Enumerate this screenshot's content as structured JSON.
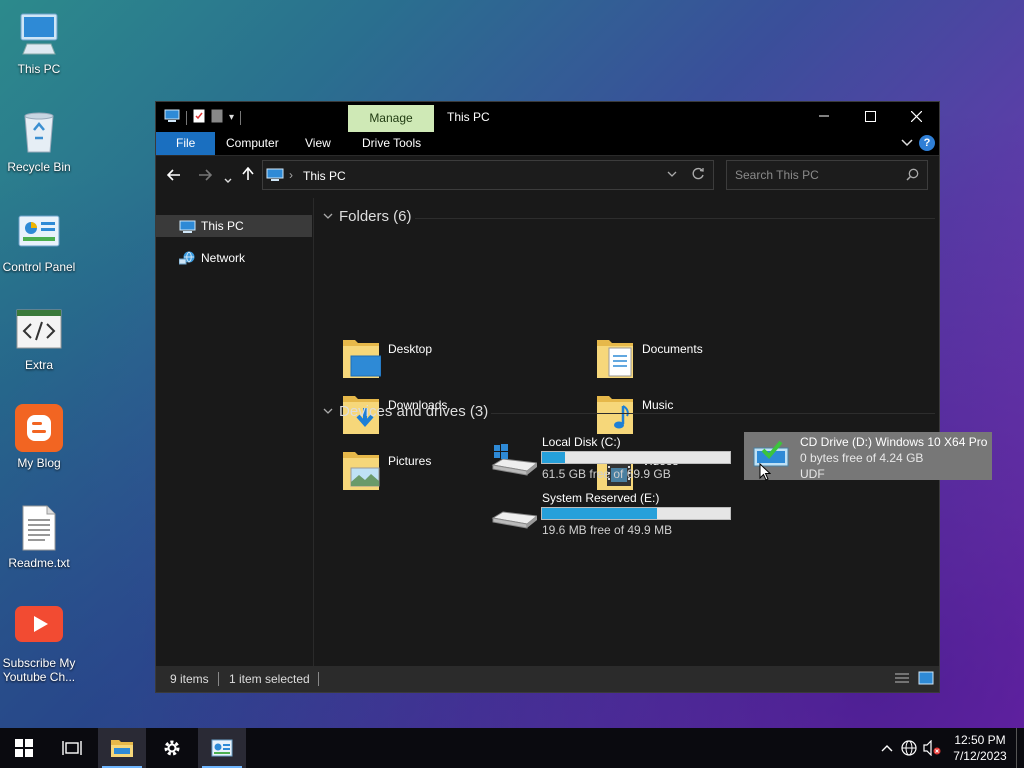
{
  "desktop": {
    "icons": [
      {
        "label": "This PC"
      },
      {
        "label": "Recycle Bin"
      },
      {
        "label": "Control Panel"
      },
      {
        "label": "Extra"
      },
      {
        "label": "My Blog"
      },
      {
        "label": "Readme.txt"
      },
      {
        "label": "Subscribe My Youtube Ch..."
      }
    ]
  },
  "window": {
    "title": "This PC",
    "context_tab": "Manage",
    "ribbon_tabs": [
      "File",
      "Computer",
      "View",
      "Drive Tools"
    ],
    "address": {
      "path": "This PC"
    },
    "search": {
      "placeholder": "Search This PC"
    },
    "nav": [
      {
        "label": "This PC",
        "selected": true
      },
      {
        "label": "Network",
        "selected": false
      }
    ],
    "groups": {
      "folders": "Folders (6)",
      "drives": "Devices and drives (3)"
    },
    "folders": [
      {
        "name": "Desktop"
      },
      {
        "name": "Documents"
      },
      {
        "name": "Downloads"
      },
      {
        "name": "Music"
      },
      {
        "name": "Pictures"
      },
      {
        "name": "Videos"
      }
    ],
    "drives": [
      {
        "name": "Local Disk (C:)",
        "free": "61.5 GB free of 69.9 GB",
        "used_fraction": 0.12
      },
      {
        "name": "System Reserved (E:)",
        "free": "19.6 MB free of 49.9 MB",
        "used_fraction": 0.61
      },
      {
        "name": "CD Drive (D:) Windows 10 X64 Pro",
        "free": "0 bytes free of 4.24 GB",
        "fs": "UDF"
      }
    ],
    "status": {
      "items": "9 items",
      "selected": "1 item selected"
    }
  },
  "taskbar": {
    "time": "12:50 PM",
    "date": "7/12/2023"
  },
  "colors": {
    "accent": "#1a6fc0",
    "manage_tab": "#cfe9b6",
    "drive_bar": "#26a0da"
  }
}
